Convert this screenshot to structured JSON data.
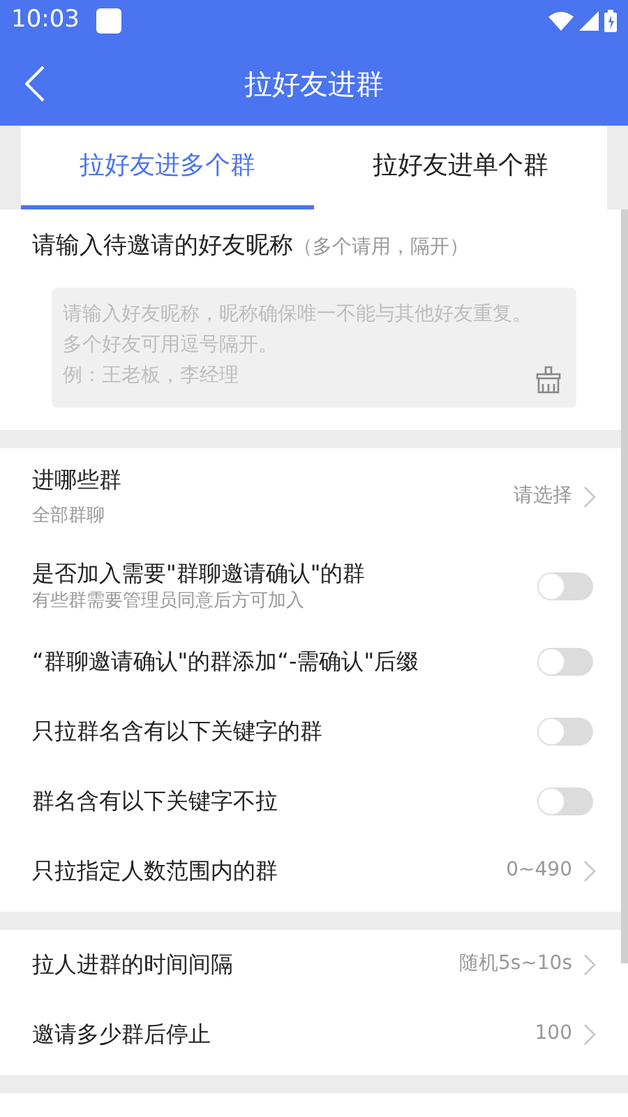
{
  "status_bar": {
    "time": "10:03"
  },
  "app_bar": {
    "title": "拉好友进群"
  },
  "tabs": [
    {
      "label": "拉好友进多个群",
      "selected": true
    },
    {
      "label": "拉好友进单个群",
      "selected": false
    }
  ],
  "nickname": {
    "label": "请输入待邀请的好友昵称",
    "hint": "（多个请用，隔开）",
    "placeholder": [
      "请输入好友昵称，昵称确保唯一不能与其他好友重复。",
      "多个好友可用逗号隔开。",
      "例：王老板，李经理"
    ]
  },
  "sections": [
    {
      "rows": [
        {
          "kind": "select",
          "title": "进哪些群",
          "subtitle": "全部群聊",
          "value": "请选择"
        },
        {
          "kind": "toggle",
          "title": "是否加入需要\"群聊邀请确认\"的群",
          "subtitle": "有些群需要管理员同意后方可加入",
          "on": false
        },
        {
          "kind": "toggle",
          "title": "“群聊邀请确认\"的群添加“-需确认\"后缀",
          "on": false
        },
        {
          "kind": "toggle",
          "title": "只拉群名含有以下关键字的群",
          "on": false
        },
        {
          "kind": "toggle",
          "title": "群名含有以下关键字不拉",
          "on": false
        },
        {
          "kind": "value",
          "title": "只拉指定人数范围内的群",
          "value": "0~490"
        }
      ]
    },
    {
      "rows": [
        {
          "kind": "value",
          "title": "拉人进群的时间间隔",
          "value": "随机5s~10s"
        },
        {
          "kind": "value",
          "title": "邀请多少群后停止",
          "value": "100"
        }
      ]
    }
  ]
}
